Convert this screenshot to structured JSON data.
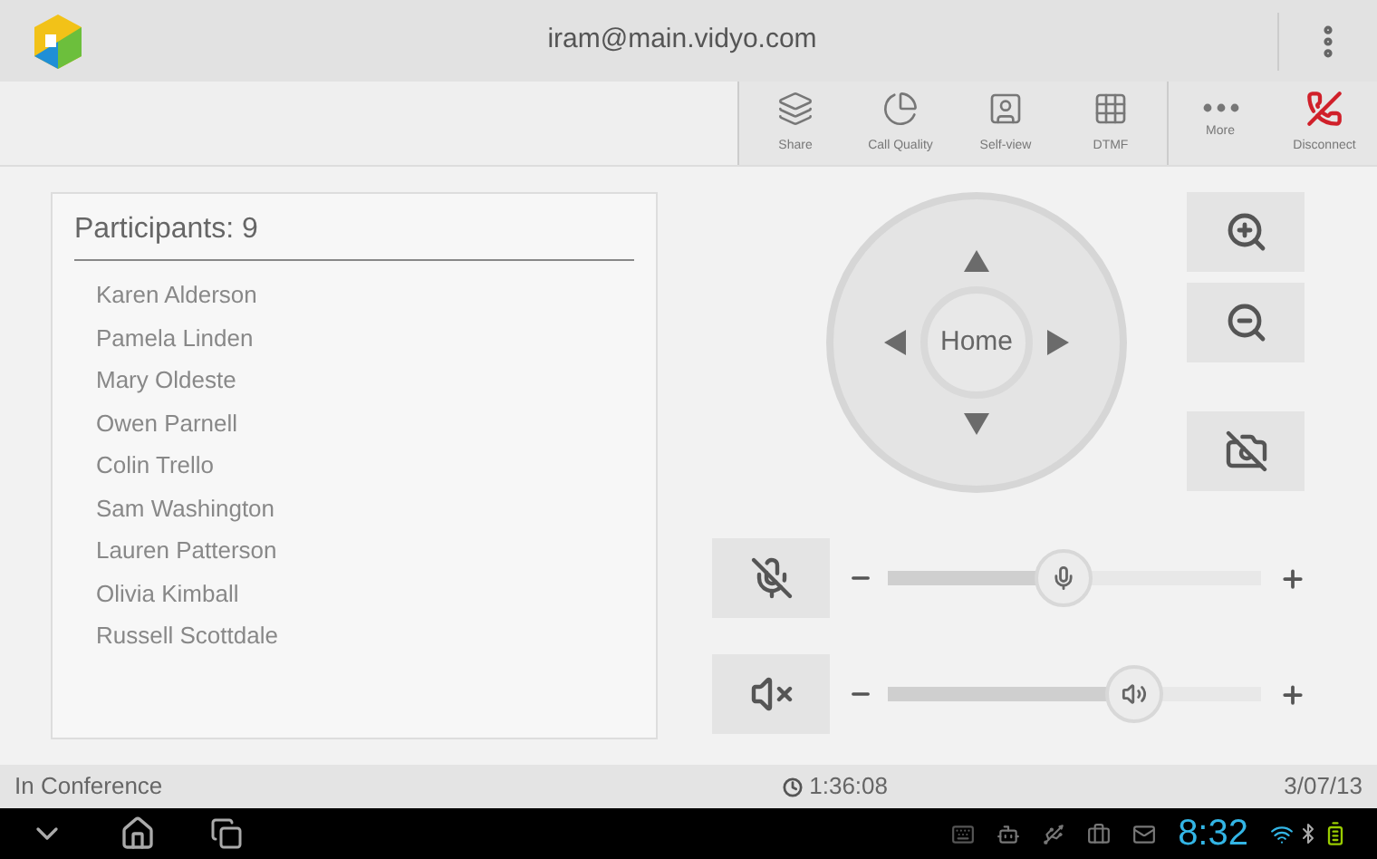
{
  "header": {
    "title": "iram@main.vidyo.com"
  },
  "toolbar": [
    {
      "kind": "share",
      "label": "Share"
    },
    {
      "kind": "quality",
      "label": "Call Quality"
    },
    {
      "kind": "selfview",
      "label": "Self-view"
    },
    {
      "kind": "dtmf",
      "label": "DTMF"
    },
    {
      "kind": "more",
      "label": "More"
    },
    {
      "kind": "disconnect",
      "label": "Disconnect"
    }
  ],
  "participants": {
    "title": "Participants: 9",
    "names": [
      "Karen Alderson",
      "Pamela Linden",
      "Mary Oldeste",
      "Owen Parnell",
      "Colin Trello",
      "Sam Washington",
      "Lauren Patterson",
      "Olivia Kimball",
      "Russell Scottdale"
    ]
  },
  "camera_control": {
    "home_label": "Home"
  },
  "sliders": [
    {
      "kind": "microphone",
      "level": 0.47
    },
    {
      "kind": "speaker",
      "level": 0.66
    }
  ],
  "status_bar": {
    "state": "In Conference",
    "duration": "1:36:08",
    "date": "3/07/13"
  },
  "system_bar": {
    "time": "8:32"
  }
}
